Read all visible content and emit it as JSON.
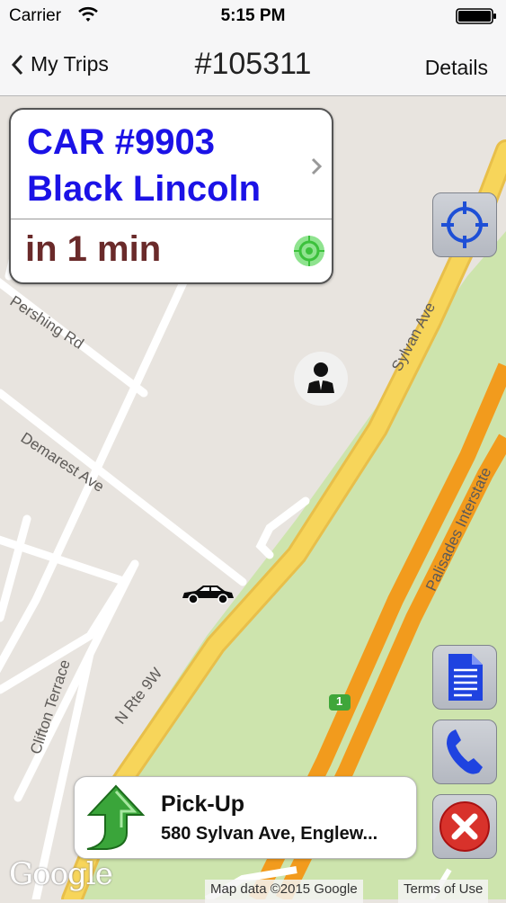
{
  "status_bar": {
    "carrier": "Carrier",
    "time": "5:15 PM"
  },
  "nav": {
    "back_label": "My Trips",
    "title": "#105311",
    "right_label": "Details"
  },
  "car_card": {
    "car_number": "CAR #9903",
    "car_desc": "Black Lincoln",
    "eta": "in 1 min"
  },
  "streets": {
    "pershing": "Pershing Rd",
    "demarest": "Demarest Ave",
    "sylvan": "Sylvan Ave",
    "rte9w": "N Rte 9W",
    "clifton": "Clifton Terrace",
    "palisades": "Palisades Interstate",
    "route_badge": "1"
  },
  "pickup": {
    "title": "Pick-Up",
    "address": "580 Sylvan Ave, Englew..."
  },
  "map_attribution": {
    "logo": "Google",
    "data": "Map data ©2015 Google",
    "terms": "Terms of Use"
  },
  "colors": {
    "car_text": "#1b12e6",
    "eta_text": "#6a2a2a",
    "highway": "#f29b1d",
    "road": "#f7d55a",
    "park": "#cde4ad"
  }
}
